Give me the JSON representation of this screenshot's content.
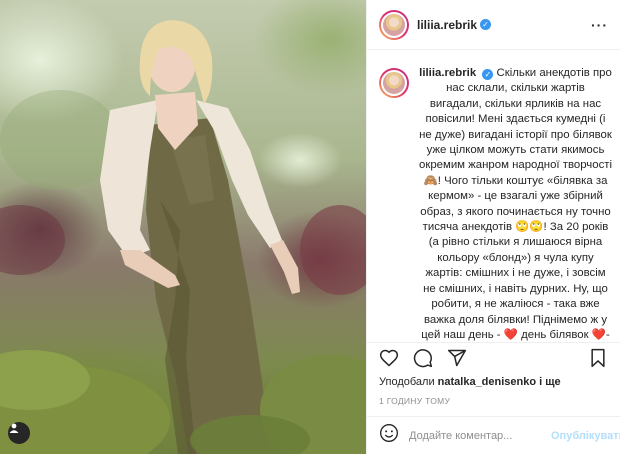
{
  "post": {
    "username": "liliia.rebrik",
    "verified": true,
    "more_icon": "more-horizontal-icon"
  },
  "caption": {
    "username": "liliia.rebrik",
    "text": "Скільки анекдотів про нас склали, скільки жартів вигадали, скільки ярликів на нас повісили! Мені здається кумедні (і не дуже) вигадані історії про білявок уже цілком можуть стати якимось окремим жанром народної творчості 🙈! Чого тільки коштує «білявка за кермом» - це взагалі уже збірний образ, з якого починається ну точно тисяча анекдотів 🙄🙄! За 20 років (а рівно стільки я лишаюся вірна кольору «блонд») я чула купу жартів: смішних і не дуже, і зовсім не смішних, і навіть дурних. Ну, що робити, я не жаліюся - така вже важка доля білявки! Піднімемо ж у цей наш день - ❤️ день білявок ❤️- келих чогось ігристого за нас, красунь 🥂! Так, про білявок не..."
  },
  "actions": {
    "icons": [
      "heart-icon",
      "comment-icon",
      "share-icon",
      "bookmark-icon"
    ]
  },
  "likes": {
    "prefix": "Уподобали",
    "user": "natalka_denisenko",
    "suffix": "і ще"
  },
  "timestamp": "1 ГОДИНУ ТОМУ",
  "comment_box": {
    "placeholder": "Додайте коментар...",
    "post_label": "Опублікувати",
    "emoji_icon": "smiley-icon"
  },
  "colors": {
    "link_blue": "#3897f0",
    "post_disabled": "#b2dffc",
    "muted": "#8e8e8e"
  }
}
